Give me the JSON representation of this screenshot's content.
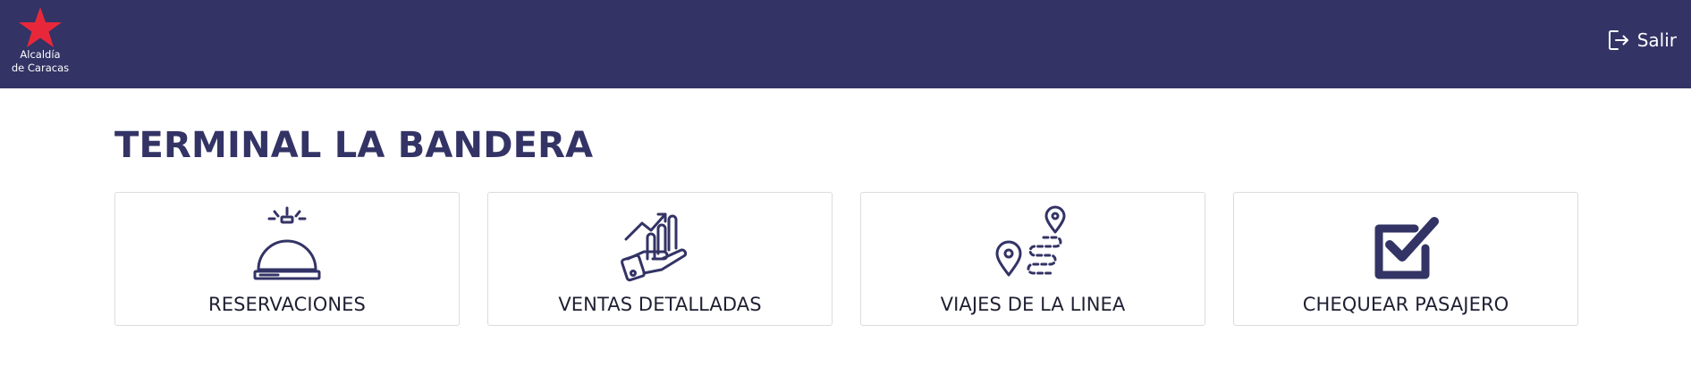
{
  "header": {
    "logo_line1": "Alcaldía",
    "logo_line2": "de Caracas",
    "logout_label": "Salir"
  },
  "main": {
    "title": "TERMINAL LA BANDERA",
    "cards": [
      {
        "label": "RESERVACIONES",
        "icon": "service-bell-icon"
      },
      {
        "label": "VENTAS DETALLADAS",
        "icon": "sales-growth-icon"
      },
      {
        "label": "VIAJES DE LA LINEA",
        "icon": "route-map-icon"
      },
      {
        "label": "CHEQUEAR PASAJERO",
        "icon": "checkbox-check-icon"
      }
    ]
  },
  "colors": {
    "primary": "#333366",
    "logo_star": "#e8283a",
    "background": "#ffffff"
  }
}
